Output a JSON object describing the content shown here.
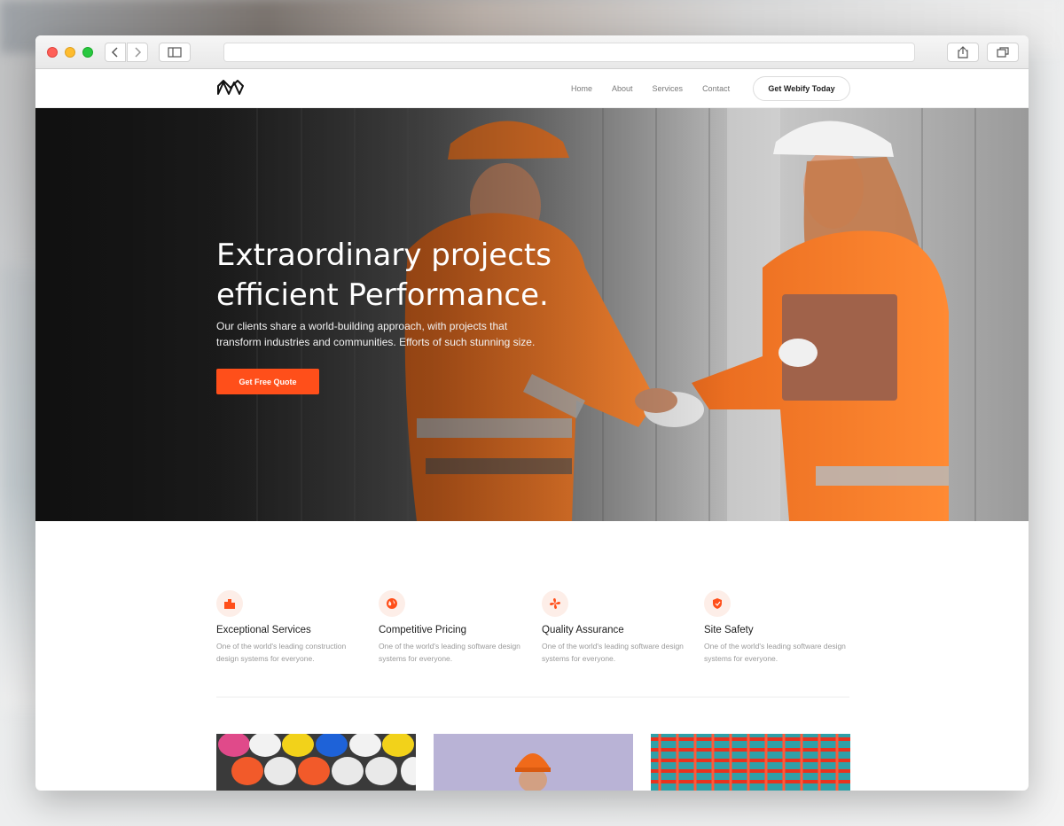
{
  "nav": {
    "items": [
      {
        "label": "Home"
      },
      {
        "label": "About"
      },
      {
        "label": "Services"
      },
      {
        "label": "Contact"
      }
    ],
    "cta_label": "Get Webify Today"
  },
  "hero": {
    "title_line1": "Extraordinary projects",
    "title_line2": "efficient Performance.",
    "subtitle": "Our clients share a world-building approach, with projects that transform industries and communities. Efforts of such stunning size.",
    "button_label": "Get Free Quote"
  },
  "features": [
    {
      "icon": "buildings-icon",
      "title": "Exceptional Services",
      "description": "One of the world's leading construction design systems for everyone."
    },
    {
      "icon": "globe-icon",
      "title": "Competitive Pricing",
      "description": "One of the world's leading software design systems for everyone."
    },
    {
      "icon": "fan-icon",
      "title": "Quality Assurance",
      "description": "One of the world's leading software design systems for everyone."
    },
    {
      "icon": "shield-icon",
      "title": "Site Safety",
      "description": "One of the world's leading software design systems for everyone."
    }
  ],
  "colors": {
    "accent": "#ff4f1a",
    "icon_bg": "#fdeee8"
  }
}
